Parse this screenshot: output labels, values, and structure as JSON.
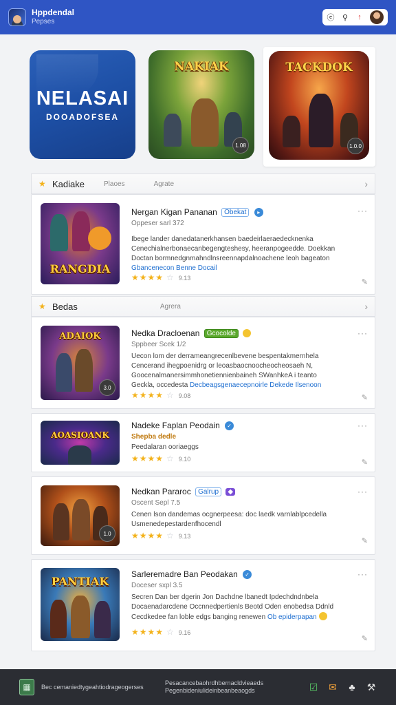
{
  "header": {
    "title": "Hppdendal",
    "subtitle": "Pepses",
    "tools": [
      "e-icon",
      "search-icon",
      "record-icon",
      "avatar"
    ]
  },
  "featured": [
    {
      "title": "NELASAI",
      "subtitle": "DOOADOFSEA"
    },
    {
      "title": "NAKIAK",
      "badge": "1.08"
    },
    {
      "title": "TACKDOK",
      "badge": "1.0.0"
    }
  ],
  "sections": [
    {
      "title": "Kadiake",
      "tabs": [
        "Plaoes",
        "Agrate"
      ]
    },
    {
      "title": "Bedas",
      "tabs": [
        "Agrera"
      ]
    }
  ],
  "cards": [
    {
      "thumb_title": "RANGDIA",
      "title": "Nergan Kigan Pananan",
      "tag": "Obekat",
      "sub": "Oppeser sarl 372",
      "desc_lines": [
        "Ibege lander danedatanerkhansen baedeirlaeraedecknenka",
        "Cenechialnerbonaecanbegengteshesy, heeranpogeedde. Doekkan",
        "Doctan bormnedgnmahndlnsreennapdalnoachene leoh bageaton"
      ],
      "desc_link": "Gbancenecon Benne Docail",
      "rating_value": 4,
      "count": "9.13"
    },
    {
      "thumb_title": "ADAIOK",
      "badge": "3.0",
      "title": "Nedka Dracloenan",
      "tag": "Gcocolde",
      "sub": "Sppbeer Scek 1/2",
      "desc_lines": [
        "Uecon lom der derrameangrecenlbevene bespentakmernhela",
        "Cencerand ihegpoenidrg or leoasbaocnoocheocheosaeh N,",
        "Goocenalmanersimmhonetiennienbaineh SWanhkeA i teanto",
        "Geckla, occedesta"
      ],
      "desc_link": "Decbeagsgenaecepnoirle Dekede Ilsenoon",
      "rating_value": 4,
      "count": "9.08"
    },
    {
      "thumb_title": "AOASIOANK",
      "title": "Nadeke Faplan Peodain",
      "sub": "Shepba dedle",
      "desc_lines": [
        "Peedalaran ooriaeggs"
      ],
      "rating_value": 4,
      "count": "9.10"
    },
    {
      "title": "Nedkan Pararoc",
      "tag": "Galrup",
      "sub": "Oscent Sepl 7.5",
      "desc_lines": [
        "Cenen lson dandemas ocgnerpeesa: doc laedk varnlablpcedella",
        "Usmenedepestardenfhocendl"
      ],
      "badge": "1.0",
      "rating_value": 4,
      "count": "9.13"
    },
    {
      "thumb_title": "PANTIAK",
      "title": "Sarleremadre Ban Peodakan",
      "sub": "Doceser sxpl 3.5",
      "desc_lines": [
        "Secren Dan ber dgerin Jon Dachdne lbanedt Ipdechdndnbela",
        "Docaenadarcdene Occnnedpertienls Beotd Oden enobedsa Ddnld",
        "Cecdkedee fan loble edgs banging renewen"
      ],
      "desc_link": "Ob epiderpapan",
      "rating_value": 4,
      "count": "9.16"
    }
  ],
  "footer": {
    "text1": "Bec cemaniedtygeahtiodrageogerses",
    "text2_line1": "Pesacancebaohrdhbernacldvieaeds",
    "text2_line2": "Pegenbideniulideinbeanbeaogds"
  }
}
